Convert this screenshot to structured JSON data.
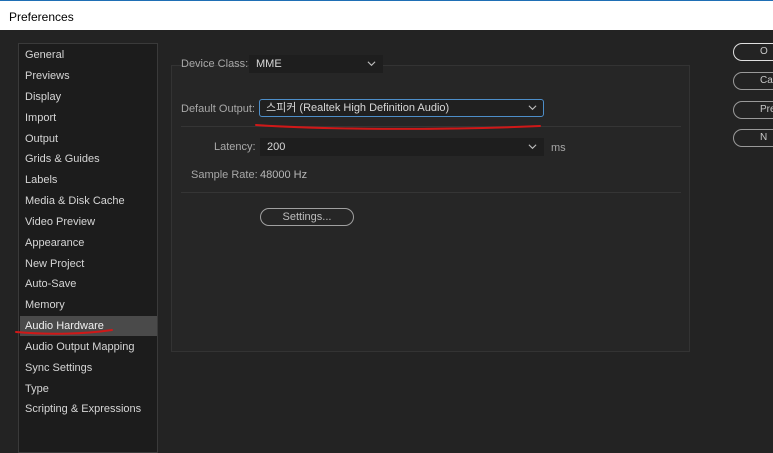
{
  "window": {
    "title": "Preferences"
  },
  "sidebar": {
    "items": [
      {
        "label": "General"
      },
      {
        "label": "Previews"
      },
      {
        "label": "Display"
      },
      {
        "label": "Import"
      },
      {
        "label": "Output"
      },
      {
        "label": "Grids & Guides"
      },
      {
        "label": "Labels"
      },
      {
        "label": "Media & Disk Cache"
      },
      {
        "label": "Video Preview"
      },
      {
        "label": "Appearance"
      },
      {
        "label": "New Project"
      },
      {
        "label": "Auto-Save"
      },
      {
        "label": "Memory"
      },
      {
        "label": "Audio Hardware"
      },
      {
        "label": "Audio Output Mapping"
      },
      {
        "label": "Sync Settings"
      },
      {
        "label": "Type"
      },
      {
        "label": "Scripting & Expressions"
      }
    ],
    "selected": "Audio Hardware"
  },
  "audio": {
    "device_class_label": "Device Class:",
    "device_class_value": "MME",
    "default_output_label": "Default Output:",
    "default_output_value": "스피커 (Realtek High Definition Audio)",
    "latency_label": "Latency:",
    "latency_value": "200",
    "latency_unit": "ms",
    "sample_rate_label": "Sample Rate:",
    "sample_rate_value": "48000 Hz",
    "settings_button": "Settings..."
  },
  "right_buttons": {
    "ok": "O",
    "cancel": "Can",
    "preview": "Prev",
    "new": "N"
  },
  "colors": {
    "accent_focus": "#4d8ec9",
    "annotation": "#d01818"
  }
}
